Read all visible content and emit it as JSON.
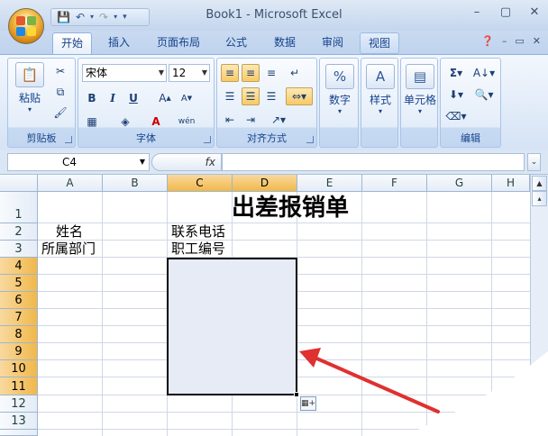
{
  "window": {
    "title": "Book1 - Microsoft Excel"
  },
  "qat": {
    "save_icon": "save-icon",
    "undo_icon": "undo-icon",
    "redo_icon": "redo-icon"
  },
  "tabs": [
    {
      "label": "开始",
      "active": true
    },
    {
      "label": "插入"
    },
    {
      "label": "页面布局"
    },
    {
      "label": "公式"
    },
    {
      "label": "数据"
    },
    {
      "label": "审阅"
    },
    {
      "label": "视图"
    }
  ],
  "ribbon": {
    "clipboard": {
      "title": "剪贴板",
      "paste": "粘贴"
    },
    "font": {
      "title": "字体",
      "font_name": "宋体",
      "font_size": "12",
      "bold": "B",
      "italic": "I",
      "underline": "U"
    },
    "alignment": {
      "title": "对齐方式"
    },
    "number": {
      "label": "数字"
    },
    "styles": {
      "label": "样式"
    },
    "cells": {
      "label": "单元格"
    },
    "editing": {
      "title": "编辑",
      "sum": "Σ"
    }
  },
  "formula_bar": {
    "name_box": "C4",
    "fx_label": "fx",
    "formula": ""
  },
  "columns": [
    "A",
    "B",
    "C",
    "D",
    "E",
    "F",
    "G",
    "H"
  ],
  "rows": [
    "1",
    "2",
    "3",
    "4",
    "5",
    "6",
    "7",
    "8",
    "9",
    "10",
    "11",
    "12",
    "13"
  ],
  "sheet": {
    "title": "出差报销单",
    "a2": "姓名",
    "a3": "所属部门",
    "c2": "联系电话",
    "c3": "职工编号"
  },
  "colors": {
    "accent": "#f1b84a",
    "arrow": "#e03030",
    "selection": "#e6ebf5"
  }
}
